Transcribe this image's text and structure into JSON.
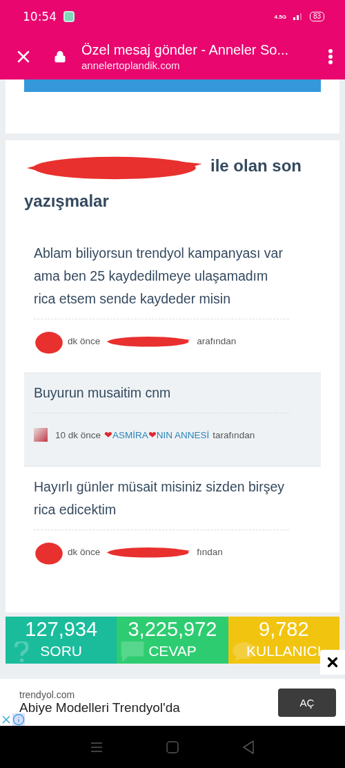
{
  "status_bar": {
    "time": "10:54",
    "network": "4.5G",
    "battery": "83"
  },
  "browser": {
    "title": "Özel mesaj gönder - Anneler So...",
    "url": "annelertoplandik.com"
  },
  "conversation": {
    "heading_redacted": true,
    "heading": [
      "ile olan son",
      "yazışmalar"
    ],
    "messages": [
      {
        "text": "Ablam biliyorsun trendyol kampanyası var ama ben 25 kaydedilmeye ulaşamadım rica etsem sende kaydeder misin",
        "highlighted": false,
        "redacted": true,
        "time": "dk önce",
        "suffix": "arafından"
      },
      {
        "text": "Buyurun musaitim cnm",
        "highlighted": true,
        "redacted": false,
        "time": "10 dk önce",
        "author": "❤ASMİRA❤NIN ANNESİ",
        "suffix": "tarafından"
      },
      {
        "text": "Hayırlı günler müsait misiniz sizden birşey rica edicektim",
        "highlighted": false,
        "redacted": true,
        "time": "dk önce",
        "suffix": "fından"
      }
    ]
  },
  "stats": [
    {
      "value": "127,934",
      "label": "SORU",
      "color": "#1abc9c",
      "kind": "question"
    },
    {
      "value": "3,225,972",
      "label": "CEVAP",
      "color": "#2ecc71",
      "kind": "answer"
    },
    {
      "value": "9,782",
      "label": "KULLANICI",
      "color": "#f1c40f",
      "kind": "users"
    }
  ],
  "ad": {
    "source": "trendyol.com",
    "title": "Abiye Modelleri Trendyol'da",
    "button": "AÇ"
  }
}
